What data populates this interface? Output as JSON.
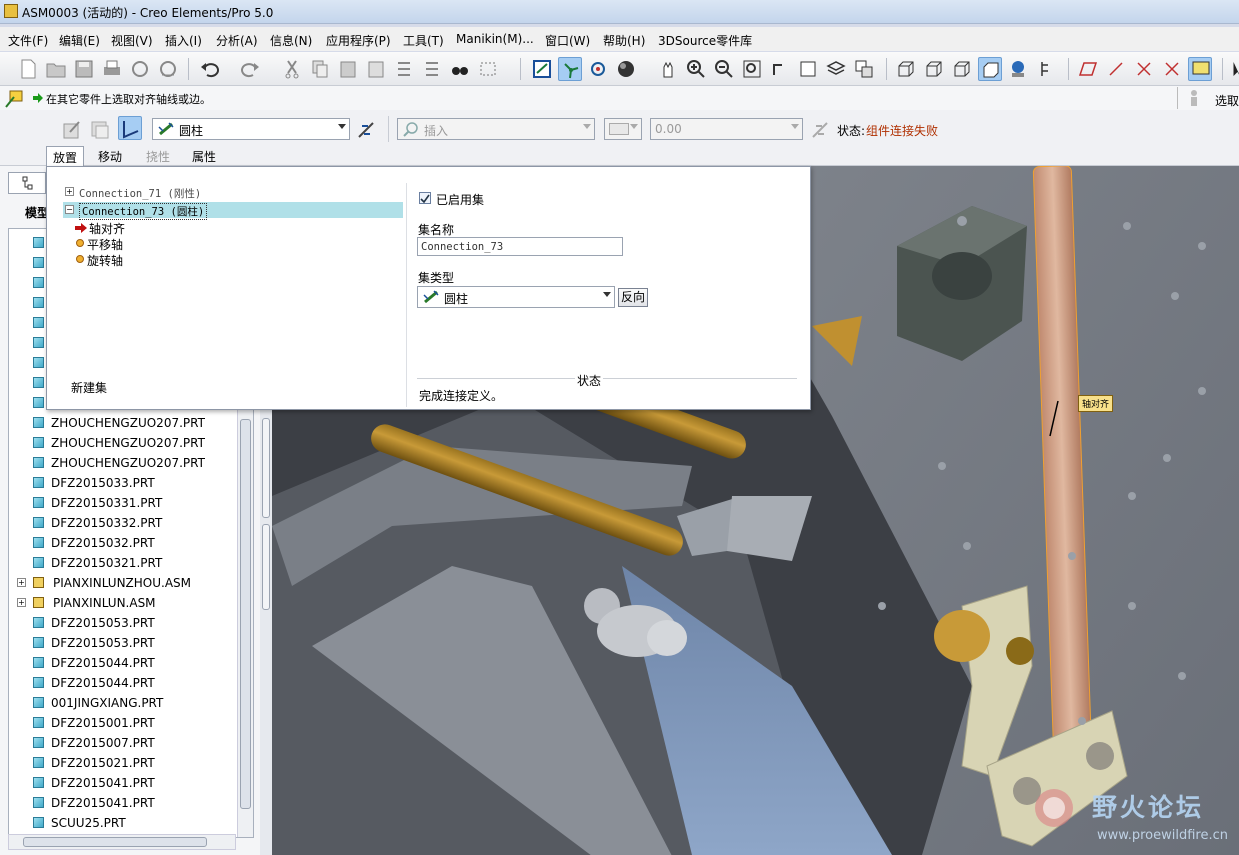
{
  "window": {
    "title": "ASM0003 (活动的) - Creo Elements/Pro 5.0"
  },
  "menu": [
    "文件(F)",
    "编辑(E)",
    "视图(V)",
    "插入(I)",
    "分析(A)",
    "信息(N)",
    "应用程序(P)",
    "工具(T)",
    "Manikin(M)...",
    "窗口(W)",
    "帮助(H)",
    "3DSource零件库"
  ],
  "message": {
    "text": "在其它零件上选取对齐轴线或边。",
    "right_label": "选取"
  },
  "dashboard": {
    "connection_type": "圆柱",
    "constraint_insert": "插入",
    "offset_value": "0.00",
    "status_label": "状态:",
    "status_value": "组件连接失败",
    "tabs": [
      "放置",
      "移动",
      "挠性",
      "属性"
    ]
  },
  "placement": {
    "sets": [
      {
        "name": "Connection_71 (刚性)",
        "expanded": false,
        "selected": false
      },
      {
        "name": "Connection_73 (圆柱)",
        "expanded": true,
        "selected": true,
        "children": [
          "轴对齐",
          "平移轴",
          "旋转轴"
        ]
      }
    ],
    "new_set": "新建集",
    "enable_set_label": "已启用集",
    "enable_set_checked": true,
    "set_name_label": "集名称",
    "set_name_value": "Connection_73",
    "set_type_label": "集类型",
    "set_type_value": "圆柱",
    "flip_label": "反向",
    "status_title": "状态",
    "status_text": "完成连接定义。"
  },
  "model_tree": {
    "tab_label": "模型",
    "items": [
      {
        "name": "ZHOUCHENGZUO207.PRT",
        "type": "part"
      },
      {
        "name": "ZHOUCHENGZUO207.PRT",
        "type": "part"
      },
      {
        "name": "ZHOUCHENGZUO207.PRT",
        "type": "part"
      },
      {
        "name": "DFZ2015033.PRT",
        "type": "packaged"
      },
      {
        "name": "DFZ20150331.PRT",
        "type": "packaged"
      },
      {
        "name": "DFZ20150332.PRT",
        "type": "packaged"
      },
      {
        "name": "DFZ2015032.PRT",
        "type": "packaged"
      },
      {
        "name": "DFZ20150321.PRT",
        "type": "packaged"
      },
      {
        "name": "PIANXINLUNZHOU.ASM",
        "type": "asm"
      },
      {
        "name": "PIANXINLUN.ASM",
        "type": "asm"
      },
      {
        "name": "DFZ2015053.PRT",
        "type": "part"
      },
      {
        "name": "DFZ2015053.PRT",
        "type": "part"
      },
      {
        "name": "DFZ2015044.PRT",
        "type": "part"
      },
      {
        "name": "DFZ2015044.PRT",
        "type": "part"
      },
      {
        "name": "001JINGXIANG.PRT",
        "type": "part"
      },
      {
        "name": "DFZ2015001.PRT",
        "type": "part"
      },
      {
        "name": "DFZ2015007.PRT",
        "type": "packaged"
      },
      {
        "name": "DFZ2015021.PRT",
        "type": "part"
      },
      {
        "name": "DFZ2015041.PRT",
        "type": "part"
      },
      {
        "name": "DFZ2015041.PRT",
        "type": "part"
      },
      {
        "name": "SCUU25.PRT",
        "type": "part"
      }
    ]
  },
  "viewport": {
    "axis_tag": "轴对齐"
  },
  "watermark": {
    "name": "野火论坛",
    "url": "www.proewildfire.cn"
  },
  "colors": {
    "status_error": "#b03000",
    "selection": "#b0e0e8",
    "accent": "#a6cdf3"
  }
}
